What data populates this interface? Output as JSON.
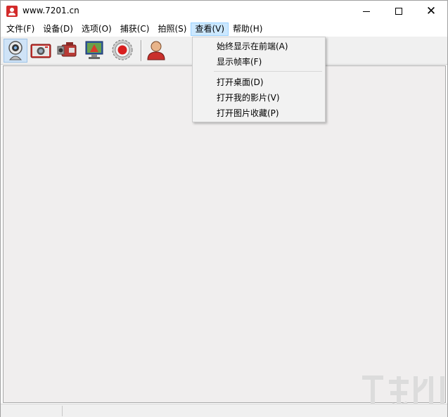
{
  "window": {
    "title": "www.7201.cn"
  },
  "menubar": {
    "items": [
      {
        "label": "文件(F)"
      },
      {
        "label": "设备(D)"
      },
      {
        "label": "选项(O)"
      },
      {
        "label": "捕获(C)"
      },
      {
        "label": "拍照(S)"
      },
      {
        "label": "查看(V)"
      },
      {
        "label": "帮助(H)"
      }
    ],
    "active_index": 5
  },
  "toolbar": {
    "buttons": [
      {
        "icon": "webcam-icon",
        "pressed": true
      },
      {
        "icon": "camera-icon",
        "pressed": false
      },
      {
        "icon": "camcorder-icon",
        "pressed": false
      },
      {
        "icon": "monitor-icon",
        "pressed": false
      },
      {
        "icon": "record-icon",
        "pressed": false
      },
      {
        "icon": "user-icon",
        "pressed": false
      }
    ]
  },
  "view_menu": {
    "items": [
      {
        "label": "始终显示在前端(A)"
      },
      {
        "label": "显示帧率(F)"
      },
      {
        "label": "打开桌面(D)"
      },
      {
        "label": "打开我的影片(V)"
      },
      {
        "label": "打开图片收藏(P)"
      }
    ]
  },
  "colors": {
    "accent_red": "#d32a2a",
    "menu_highlight": "#cce8ff",
    "main_bg": "#f0eeee"
  }
}
